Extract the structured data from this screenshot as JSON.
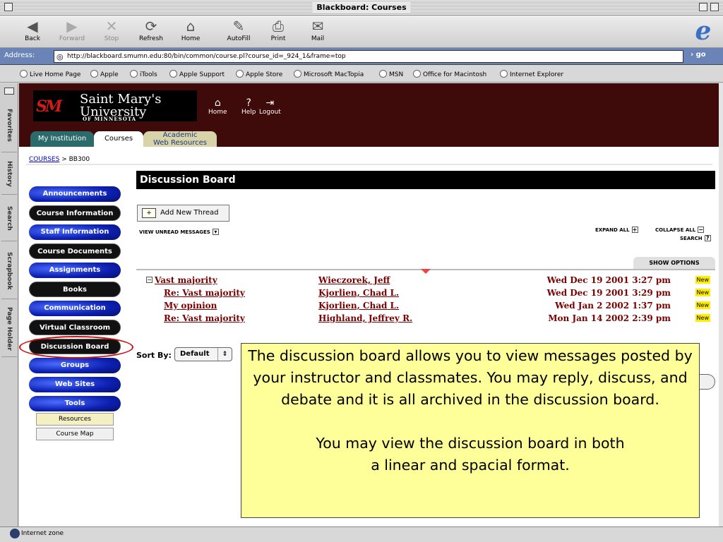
{
  "window": {
    "title": "Blackboard: Courses"
  },
  "toolbar": {
    "buttons": [
      {
        "label": "Back",
        "icon": "back-arrow-icon",
        "glyph": "◀"
      },
      {
        "label": "Forward",
        "icon": "forward-arrow-icon",
        "glyph": "▶"
      },
      {
        "label": "Stop",
        "icon": "stop-icon",
        "glyph": "✕"
      },
      {
        "label": "Refresh",
        "icon": "refresh-icon",
        "glyph": "⟳"
      },
      {
        "label": "Home",
        "icon": "home-icon",
        "glyph": "⌂"
      },
      {
        "label": "AutoFill",
        "icon": "autofill-icon",
        "glyph": "✎"
      },
      {
        "label": "Print",
        "icon": "printer-icon",
        "glyph": "⎙"
      },
      {
        "label": "Mail",
        "icon": "mail-icon",
        "glyph": "✉"
      }
    ],
    "logo": "e"
  },
  "address": {
    "label": "Address:",
    "url": "http://blackboard.smumn.edu:80/bin/common/course.pl?course_id=_924_1&frame=top",
    "go": "› go"
  },
  "favorites": [
    "Live Home Page",
    "Apple",
    "iTools",
    "Apple Support",
    "Apple Store",
    "Microsoft MacTopia",
    "MSN",
    "Office for Macintosh",
    "Internet Explorer"
  ],
  "sidetabs": [
    "Favorites",
    "History",
    "Search",
    "Scrapbook",
    "Page Holder"
  ],
  "site": {
    "logo": {
      "mark": "SM",
      "line1": "Saint Mary's",
      "line2": "University",
      "line3": "OF MINNESOTA"
    },
    "header_icons": [
      {
        "label": "Home",
        "glyph": "⌂"
      },
      {
        "label": "Help",
        "glyph": "?"
      },
      {
        "label": "Logout",
        "glyph": "⇥"
      }
    ],
    "tabs": [
      "My Institution",
      "Courses",
      "Academic\nWeb Resources"
    ],
    "breadcrumb": {
      "link": "COURSES",
      "rest": "> BB300"
    }
  },
  "menu": {
    "items": [
      "Announcements",
      "Course Information",
      "Staff Information",
      "Course Documents",
      "Assignments",
      "Books",
      "Communication",
      "Virtual Classroom",
      "Discussion Board",
      "Groups",
      "Web Sites",
      "Tools"
    ],
    "small": [
      "Resources",
      "Course Map"
    ]
  },
  "board": {
    "title": "Discussion Board",
    "add_thread": "Add New Thread",
    "view_unread": "VIEW UNREAD MESSAGES",
    "expand_all": "EXPAND  ALL",
    "collapse_all": "COLLAPSE  ALL",
    "search": "SEARCH",
    "show_options": "SHOW OPTIONS",
    "new_label": "New",
    "messages": [
      {
        "subject": "Vast majority",
        "author": "Wieczorek, Jeff",
        "date": "Wed Dec 19 2001 3:27 pm"
      },
      {
        "subject": "Re: Vast majority",
        "author": "Kjorlien, Chad L.",
        "date": "Wed Dec 19 2001 3:29 pm"
      },
      {
        "subject": "My opinion",
        "author": "Kjorlien, Chad L.",
        "date": "Wed Jan 2 2002 1:37 pm"
      },
      {
        "subject": "Re: Vast majority",
        "author": "Highland, Jeffrey R.",
        "date": "Mon Jan 14 2002 2:39 pm"
      }
    ],
    "sort_label": "Sort By:",
    "sort_value": "Default"
  },
  "callout": {
    "p1": "The discussion board allows you to view messages posted by your instructor and classmates.  You may reply, discuss, and debate and it is all archived in the discussion board.",
    "p2a": "You may view the discussion board in both",
    "p2b": "a linear and spacial format."
  },
  "status": {
    "zone": "Internet zone"
  }
}
